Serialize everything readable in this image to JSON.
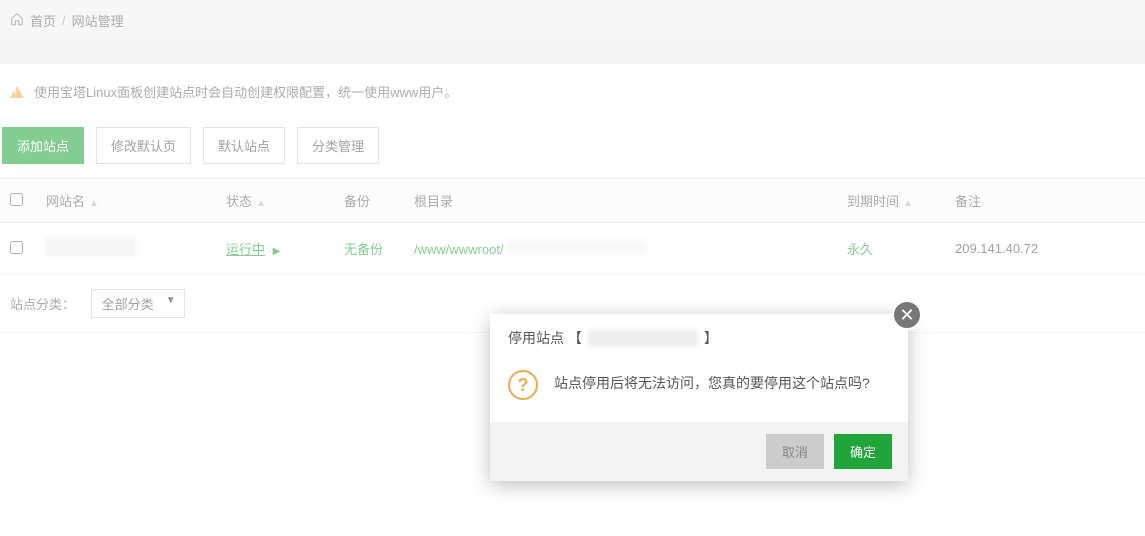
{
  "breadcrumb": {
    "home": "首页",
    "sep": "/",
    "current": "网站管理"
  },
  "alert": {
    "text": "使用宝塔Linux面板创建站点时会自动创建权限配置，统一使用www用户。"
  },
  "toolbar": {
    "add": "添加站点",
    "modify_default": "修改默认页",
    "default_site": "默认站点",
    "category": "分类管理"
  },
  "table": {
    "headers": {
      "name": "网站名",
      "status": "状态",
      "backup": "备份",
      "root": "根目录",
      "expire": "到期时间",
      "notes": "备注"
    },
    "row": {
      "status": "运行中",
      "backup": "无备份",
      "root_prefix": "/www/wwwroot/",
      "expire": "永久",
      "notes": "209.141.40.72"
    },
    "footer": {
      "label": "站点分类：",
      "select": "全部分类"
    }
  },
  "modal": {
    "title_prefix": "停用站点 【",
    "title_suffix": "】",
    "message": "站点停用后将无法访问，您真的要停用这个站点吗?",
    "cancel": "取消",
    "confirm": "确定"
  }
}
